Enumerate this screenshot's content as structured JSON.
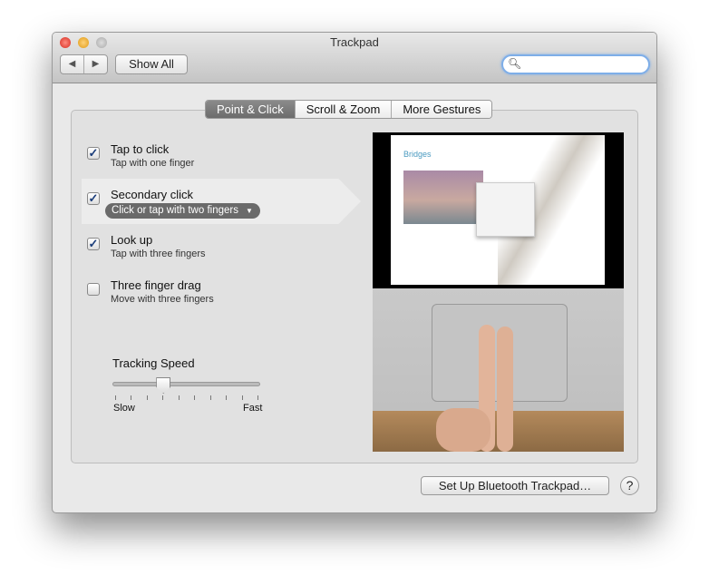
{
  "window": {
    "title": "Trackpad",
    "show_all": "Show All",
    "search": {
      "value": "",
      "placeholder": ""
    }
  },
  "tabs": [
    {
      "label": "Point & Click",
      "selected": true
    },
    {
      "label": "Scroll & Zoom",
      "selected": false
    },
    {
      "label": "More Gestures",
      "selected": false
    }
  ],
  "options": [
    {
      "title": "Tap to click",
      "subtitle": "Tap with one finger",
      "checked": true
    },
    {
      "title": "Secondary click",
      "subtitle": "Click or tap with two fingers",
      "checked": true
    },
    {
      "title": "Look up",
      "subtitle": "Tap with three fingers",
      "checked": true
    },
    {
      "title": "Three finger drag",
      "subtitle": "Move with three fingers",
      "checked": false
    }
  ],
  "tracking": {
    "label": "Tracking Speed",
    "min_label": "Slow",
    "max_label": "Fast",
    "value_fraction": 0.333,
    "ticks": 10
  },
  "preview": {
    "doc_title": "Bridges"
  },
  "footer": {
    "bluetooth_button": "Set Up Bluetooth Trackpad…",
    "help": "?"
  },
  "colors": {
    "checkbox": "#1a3d7a",
    "selected_tab": "#777777",
    "search_focus": "#7eaee8"
  }
}
